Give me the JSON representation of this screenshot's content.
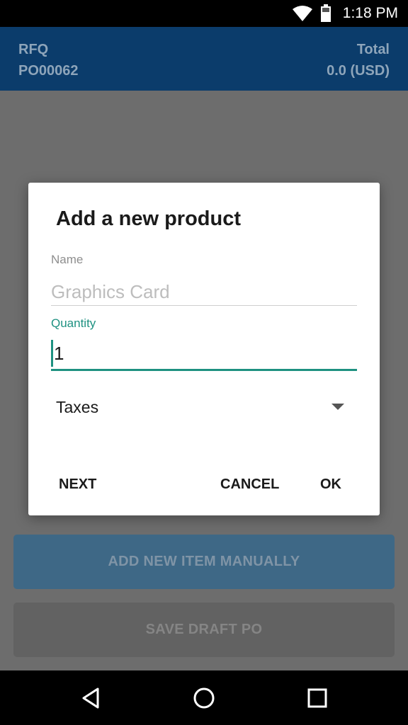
{
  "status_bar": {
    "time": "1:18 PM",
    "icons": [
      "wifi-icon",
      "battery-icon"
    ]
  },
  "header": {
    "rfq_label": "RFQ",
    "rfq_value": "PO00062",
    "total_label": "Total",
    "total_value": "0.0 (USD)"
  },
  "dialog": {
    "title": "Add a new product",
    "name_label": "Name",
    "name_placeholder": "Graphics Card",
    "quantity_label": "Quantity",
    "quantity_value": "1",
    "taxes_label": "Taxes",
    "next_label": "NEXT",
    "cancel_label": "CANCEL",
    "ok_label": "OK"
  },
  "background_buttons": {
    "add_item_label": "ADD NEW ITEM MANUALLY",
    "save_draft_label": "SAVE DRAFT PO"
  },
  "colors": {
    "header_bg": "#0b3c6b",
    "accent": "#1e9181",
    "overlay": "#6d6d6d"
  },
  "nav_bar": {
    "icons": [
      "back-icon",
      "home-icon",
      "recents-icon"
    ]
  }
}
